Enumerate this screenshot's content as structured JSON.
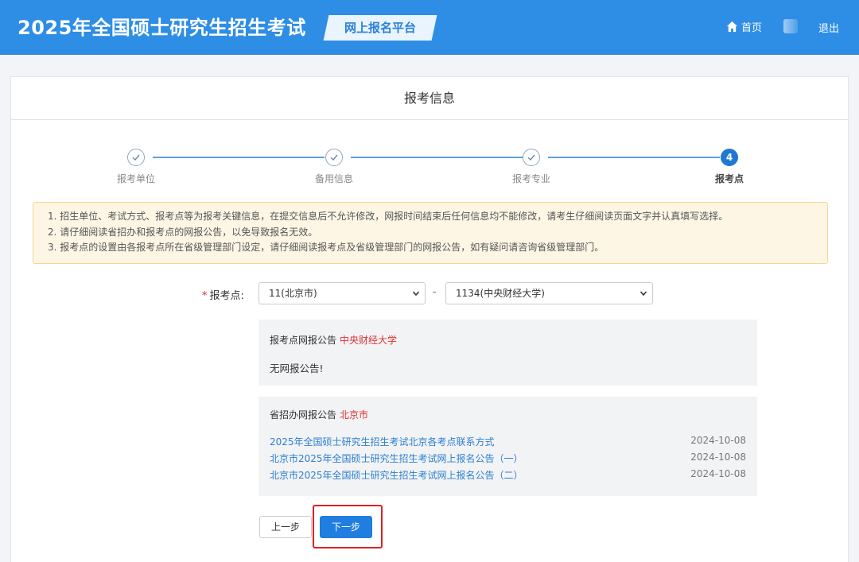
{
  "header": {
    "title": "2025年全国硕士研究生招生考试",
    "platform": "网上报名平台",
    "home_label": "首页",
    "logout_label": "退出"
  },
  "page": {
    "card_title": "报考信息"
  },
  "steps": [
    {
      "label": "报考单位",
      "status": "done"
    },
    {
      "label": "备用信息",
      "status": "done"
    },
    {
      "label": "报考专业",
      "status": "done"
    },
    {
      "label": "报考点",
      "status": "active",
      "number": "4"
    }
  ],
  "notice": {
    "lines": [
      "1. 招生单位、考试方式、报考点等为报考关键信息，在提交信息后不允许修改，网报时间结束后任何信息均不能修改，请考生仔细阅读页面文字并认真填写选择。",
      "2. 请仔细阅读省招办和报考点的网报公告，以免导致报名无效。",
      "3. 报考点的设置由各报考点所在省级管理部门设定，请仔细阅读报考点及省级管理部门的网报公告，如有疑问请咨询省级管理部门。"
    ]
  },
  "form": {
    "label": "报考点:",
    "province_select": "11(北京市)",
    "separator": "-",
    "site_select": "1134(中央财经大学)"
  },
  "site_announcement": {
    "title": "报考点网报公告",
    "highlight": "中央财经大学",
    "body": "无网报公告!"
  },
  "provincial_announcement": {
    "title": "省招办网报公告",
    "highlight": "北京市",
    "items": [
      {
        "text": "2025年全国硕士研究生招生考试北京各考点联系方式",
        "date": "2024-10-08"
      },
      {
        "text": "北京市2025年全国硕士研究生招生考试网上报名公告（一）",
        "date": "2024-10-08"
      },
      {
        "text": "北京市2025年全国硕士研究生招生考试网上报名公告（二）",
        "date": "2024-10-08"
      }
    ]
  },
  "buttons": {
    "prev": "上一步",
    "next": "下一步"
  },
  "colors": {
    "header_bg": "#2e8ee6",
    "primary": "#1f7ee0",
    "required": "#e0312f",
    "highlight_border": "#e02020"
  }
}
